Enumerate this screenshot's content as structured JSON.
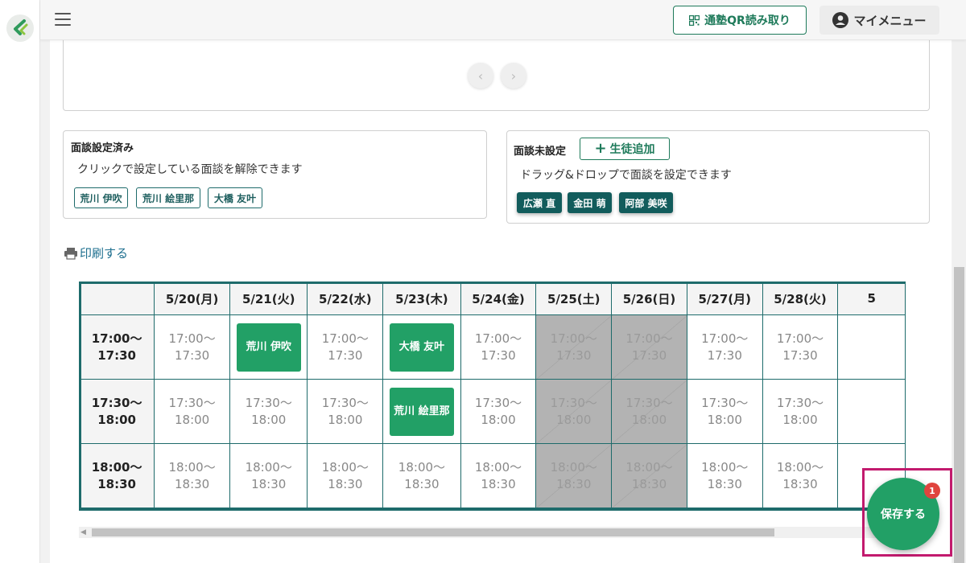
{
  "header": {
    "qr_button_label": "通塾QR読み取り",
    "my_menu_label": "マイメニュー"
  },
  "set_panel": {
    "title": "面談設定済み",
    "hint": "クリックで設定している面談を解除できます",
    "students": [
      "荒川 伊吹",
      "荒川 絵里那",
      "大橋 友叶"
    ]
  },
  "unset_panel": {
    "title": "面談未設定",
    "add_button_label": "生徒追加",
    "hint": "ドラッグ&ドロップで面談を設定できます",
    "students": [
      "広瀬 直",
      "金田 萌",
      "阿部 美咲"
    ]
  },
  "print_label": "印刷する",
  "schedule": {
    "dates": [
      "5/20(月)",
      "5/21(火)",
      "5/22(水)",
      "5/23(木)",
      "5/24(金)",
      "5/25(土)",
      "5/26(日)",
      "5/27(月)",
      "5/28(火)",
      "5"
    ],
    "rows": [
      {
        "time_start": "17:00〜",
        "time_end": "17:30",
        "cells": [
          {
            "start": "17:00〜",
            "end": "17:30"
          },
          {
            "booked": "荒川 伊吹"
          },
          {
            "start": "17:00〜",
            "end": "17:30"
          },
          {
            "booked": "大橋 友叶"
          },
          {
            "start": "17:00〜",
            "end": "17:30"
          },
          {
            "start": "17:00〜",
            "end": "17:30",
            "closed": true
          },
          {
            "start": "17:00〜",
            "end": "17:30",
            "closed": true
          },
          {
            "start": "17:00〜",
            "end": "17:30"
          },
          {
            "start": "17:00〜",
            "end": "17:30"
          },
          {
            "start": "",
            "end": ""
          }
        ]
      },
      {
        "time_start": "17:30〜",
        "time_end": "18:00",
        "cells": [
          {
            "start": "17:30〜",
            "end": "18:00"
          },
          {
            "start": "17:30〜",
            "end": "18:00"
          },
          {
            "start": "17:30〜",
            "end": "18:00"
          },
          {
            "booked": "荒川 絵里那"
          },
          {
            "start": "17:30〜",
            "end": "18:00"
          },
          {
            "start": "17:30〜",
            "end": "18:00",
            "closed": true
          },
          {
            "start": "17:30〜",
            "end": "18:00",
            "closed": true
          },
          {
            "start": "17:30〜",
            "end": "18:00"
          },
          {
            "start": "17:30〜",
            "end": "18:00"
          },
          {
            "start": "",
            "end": ""
          }
        ]
      },
      {
        "time_start": "18:00〜",
        "time_end": "18:30",
        "cells": [
          {
            "start": "18:00〜",
            "end": "18:30"
          },
          {
            "start": "18:00〜",
            "end": "18:30"
          },
          {
            "start": "18:00〜",
            "end": "18:30"
          },
          {
            "start": "18:00〜",
            "end": "18:30"
          },
          {
            "start": "18:00〜",
            "end": "18:30"
          },
          {
            "start": "18:00〜",
            "end": "18:30",
            "closed": true
          },
          {
            "start": "18:00〜",
            "end": "18:30",
            "closed": true
          },
          {
            "start": "18:00〜",
            "end": "18:30"
          },
          {
            "start": "18:00〜",
            "end": "18:30"
          },
          {
            "start": "",
            "end": ""
          }
        ]
      }
    ]
  },
  "save_button": {
    "label": "保存する",
    "badge_count": "1"
  },
  "colors": {
    "brand_green": "#22a066",
    "dark_teal": "#125c5c",
    "highlight": "#c21a6e",
    "badge_red": "#e0443e"
  },
  "icons": [
    "logo-icon",
    "hamburger-icon",
    "qr-code-icon",
    "account-circle-icon",
    "chevron-left-icon",
    "chevron-right-icon",
    "plus-icon",
    "printer-icon",
    "scroll-left-icon"
  ]
}
